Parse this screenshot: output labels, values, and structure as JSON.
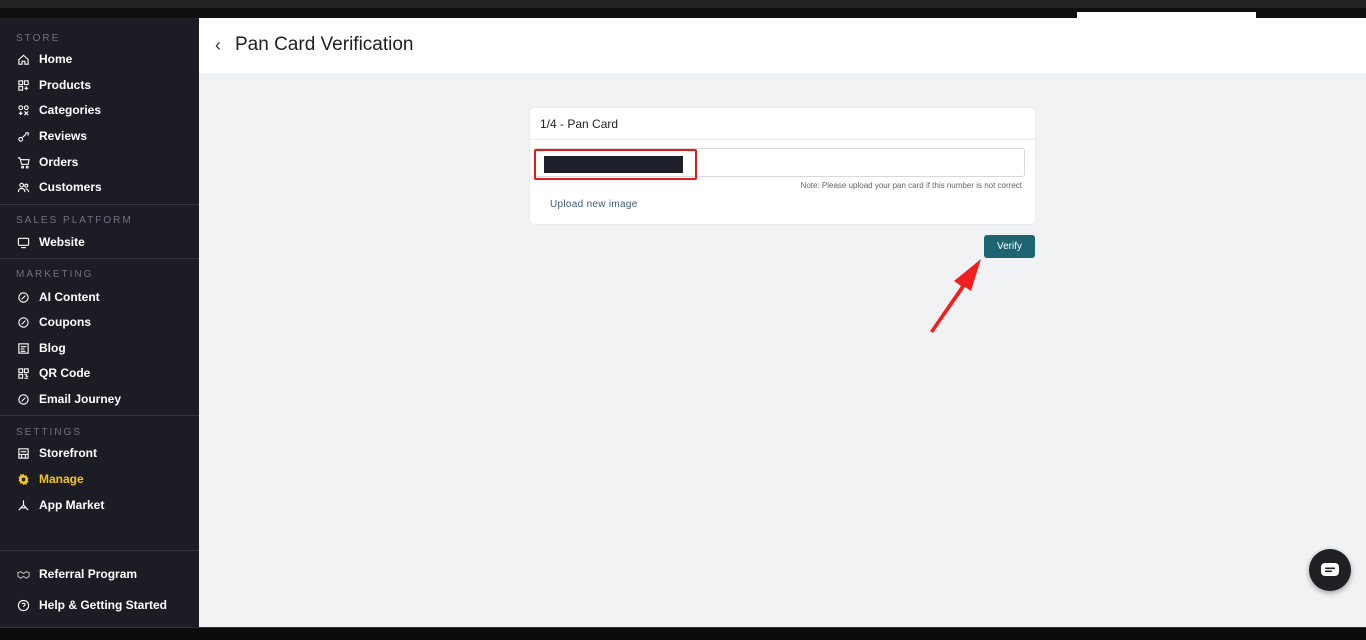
{
  "sidebar": {
    "sections": {
      "store": "STORE",
      "sales": "SALES PLATFORM",
      "marketing": "MARKETING",
      "settings": "SETTINGS"
    },
    "items": [
      {
        "label": "Home",
        "icon": "home-icon"
      },
      {
        "label": "Products",
        "icon": "products-icon"
      },
      {
        "label": "Categories",
        "icon": "categories-icon"
      },
      {
        "label": "Reviews",
        "icon": "reviews-icon"
      },
      {
        "label": "Orders",
        "icon": "cart-icon"
      },
      {
        "label": "Customers",
        "icon": "customers-icon"
      },
      {
        "label": "Website",
        "icon": "monitor-icon"
      },
      {
        "label": "AI Content",
        "icon": "badge-icon"
      },
      {
        "label": "Coupons",
        "icon": "badge-icon"
      },
      {
        "label": "Blog",
        "icon": "blog-icon"
      },
      {
        "label": "QR Code",
        "icon": "qr-icon"
      },
      {
        "label": "Email Journey",
        "icon": "badge-icon"
      },
      {
        "label": "Storefront",
        "icon": "storefront-icon"
      },
      {
        "label": "Manage",
        "icon": "gear-icon"
      },
      {
        "label": "App Market",
        "icon": "app-market-icon"
      },
      {
        "label": "Referral Program",
        "icon": "handshake-icon"
      },
      {
        "label": "Help & Getting Started",
        "icon": "help-icon"
      }
    ],
    "active_item": "Manage",
    "active_color": "#f5c518"
  },
  "header": {
    "back_glyph": "‹",
    "title": "Pan Card Verification"
  },
  "card": {
    "step": "1/4 - Pan Card",
    "pan_value": "",
    "note": "Note: Please upload your pan card if this number is not correct",
    "upload_link": "Upload new image"
  },
  "verify_label": "Verify",
  "colors": {
    "sidebar_bg": "#1b1c24",
    "verify_bg": "#1e6574",
    "highlight": "#e11a1a"
  }
}
